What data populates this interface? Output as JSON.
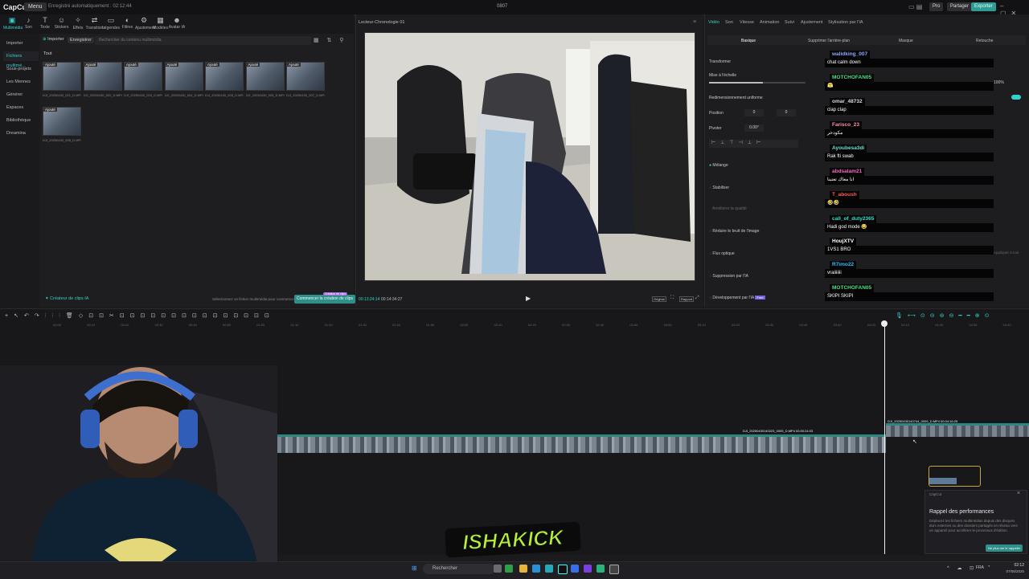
{
  "app": {
    "logo": "CapCut",
    "menu": "Menu",
    "autosave": "Enregistré automatiquement : 02:12:44",
    "project_title": "0807",
    "pro_label": "Pro",
    "share_label": "Partager",
    "export_label": "Exporter"
  },
  "tools": [
    {
      "label": "Multimédia",
      "icon": "media-icon"
    },
    {
      "label": "Son",
      "icon": "audio-icon"
    },
    {
      "label": "Texte",
      "icon": "text-icon"
    },
    {
      "label": "Stickers",
      "icon": "sticker-icon"
    },
    {
      "label": "Effets",
      "icon": "effects-icon"
    },
    {
      "label": "Transitions",
      "icon": "transitions-icon"
    },
    {
      "label": "Légendes",
      "icon": "captions-icon"
    },
    {
      "label": "Filtres",
      "icon": "filters-icon"
    },
    {
      "label": "Ajustement",
      "icon": "adjust-icon"
    },
    {
      "label": "Modèles",
      "icon": "templates-icon"
    },
    {
      "label": "Avatar IA",
      "icon": "avatar-icon"
    }
  ],
  "leftnav": [
    "Importer",
    "Fichiers multimé...",
    "Sous-projets",
    "Les Mennes",
    "Générer",
    "Espaces",
    "Bibliothèque",
    "Dreamina"
  ],
  "media": {
    "import_label": "Importer",
    "record_label": "Enregistrer",
    "search_placeholder": "Rechercher du contenu multimédia",
    "all_label": "Tout",
    "clips": [
      {
        "tag": "Ajouté",
        "name": "DJI_20250430_001_D.MP4"
      },
      {
        "tag": "Ajouté",
        "name": "DJI_20250430_002_D.MP4"
      },
      {
        "tag": "Ajouté",
        "name": "DJI_20250430_003_D.MP4"
      },
      {
        "tag": "Ajouté",
        "name": "DJI_20250430_004_D.MP4"
      },
      {
        "tag": "Ajouté",
        "name": "DJI_20250430_005_D.MP4"
      },
      {
        "tag": "Ajouté",
        "name": "DJI_20250430_006_D.MP4"
      },
      {
        "tag": "Ajouté",
        "name": "DJI_20250430_007_D.MP4"
      },
      {
        "tag": "Ajouté",
        "name": "DJI_20250430_008_D.MP4"
      }
    ],
    "creator_label": "Créateur de clips IA",
    "select_hint": "Sélectionnez un fichier multimédia pour commencer",
    "clips_btn": "Commencer la création de clips",
    "new_badge": "Création de clips"
  },
  "player": {
    "title": "Lecteur-Chronologie 01",
    "time_current": "00:13:24:14",
    "time_total": "00:14:34:27",
    "ratio_label": "Original",
    "quality_label": "Rapport"
  },
  "right": {
    "tabs": [
      "Vidéo",
      "Son",
      "Vitesse",
      "Animation",
      "Suivi",
      "Ajustement",
      "Stylisation par l'IA"
    ],
    "subtabs": [
      "Basique",
      "Supprimer l'arrière-plan",
      "Masque",
      "Retouche"
    ],
    "transform": "Transformer",
    "scale": "Mise à l'échelle",
    "scale_value": "100%",
    "uniform": "Redimensionnement uniforme",
    "position": "Position",
    "pos_x": "0",
    "pos_y": "0",
    "rotate": "Pivoter",
    "rotate_value": "0.00°",
    "blend": "Mélange",
    "stabilize": "Stabiliser",
    "quality": "Améliorer la qualité",
    "denoise": "Réduire le bruit de l'image",
    "optical_flow": "Flux optique",
    "ai_remove": "Suppression par l'IA",
    "ai_dev": "Développement par l'IA",
    "free_badge": "Free",
    "apply_all": "Appliquer à tout"
  },
  "chat": [
    {
      "user": "walidking_007",
      "msg": "chat calm down",
      "color": "#8fa8ff"
    },
    {
      "user": "MOTCHOFAN05",
      "msg": "😤",
      "color": "#4be08a"
    },
    {
      "user": "omar_48732",
      "msg": "clap clap",
      "color": "#d9d9d9"
    },
    {
      "user": "Farisco_23",
      "msg": "مكودخر",
      "color": "#ff8fb0"
    },
    {
      "user": "Ayoubesa3di",
      "msg": "Rak fti swab",
      "color": "#6ee0d8"
    },
    {
      "user": "abdsalam21",
      "msg": "انا معاك تعتبنا",
      "color": "#ff66c4"
    },
    {
      "user": "T_aboush",
      "msg": "🤣🤣",
      "color": "#ff5a5a"
    },
    {
      "user": "call_of_duty2365",
      "msg": "Hadi god mode 😂",
      "color": "#33e0d0"
    },
    {
      "user": "HoujXTV",
      "msg": "1VS1 BRO",
      "color": "#ffffff"
    },
    {
      "user": "R7imo22",
      "msg": "vraiiiiiii",
      "color": "#30c0ff"
    },
    {
      "user": "MOTCHOFAN05",
      "msg": "SKIPI SKIPI",
      "color": "#4be08a"
    }
  ],
  "timeline": {
    "clip_label_1": "DJI_20250430140223_0009_D.MP4   00:00:24:03",
    "clip_label_2": "DJI_20250430140744_0009_D.MP4   00:04:16:25",
    "ruler": [
      "00:00",
      "00:10",
      "00:20",
      "00:30",
      "00:40",
      "00:50",
      "01:00",
      "01:10",
      "01:20",
      "01:30",
      "01:40",
      "01:50",
      "02:00",
      "02:10",
      "02:20",
      "02:30",
      "02:40",
      "02:50",
      "03:00",
      "03:10",
      "03:20",
      "03:30",
      "03:40",
      "03:50",
      "04:00",
      "04:10",
      "04:20",
      "04:30",
      "04:40",
      "04:50"
    ]
  },
  "toast": {
    "app": "CapCut",
    "title": "Rappel des performances",
    "body": "Déplacez les fichiers multimédias depuis des disques durs externes ou des dossiers partagés en réseau vers un appareil pour accélérer le processus d'édition.",
    "btn": "Ne plus me le rappeler"
  },
  "stream": {
    "overlay": "ISHAKICK"
  },
  "taskbar": {
    "search": "Rechercher",
    "lang": "FRA",
    "time": "02:12",
    "date": "07/08/2025"
  }
}
